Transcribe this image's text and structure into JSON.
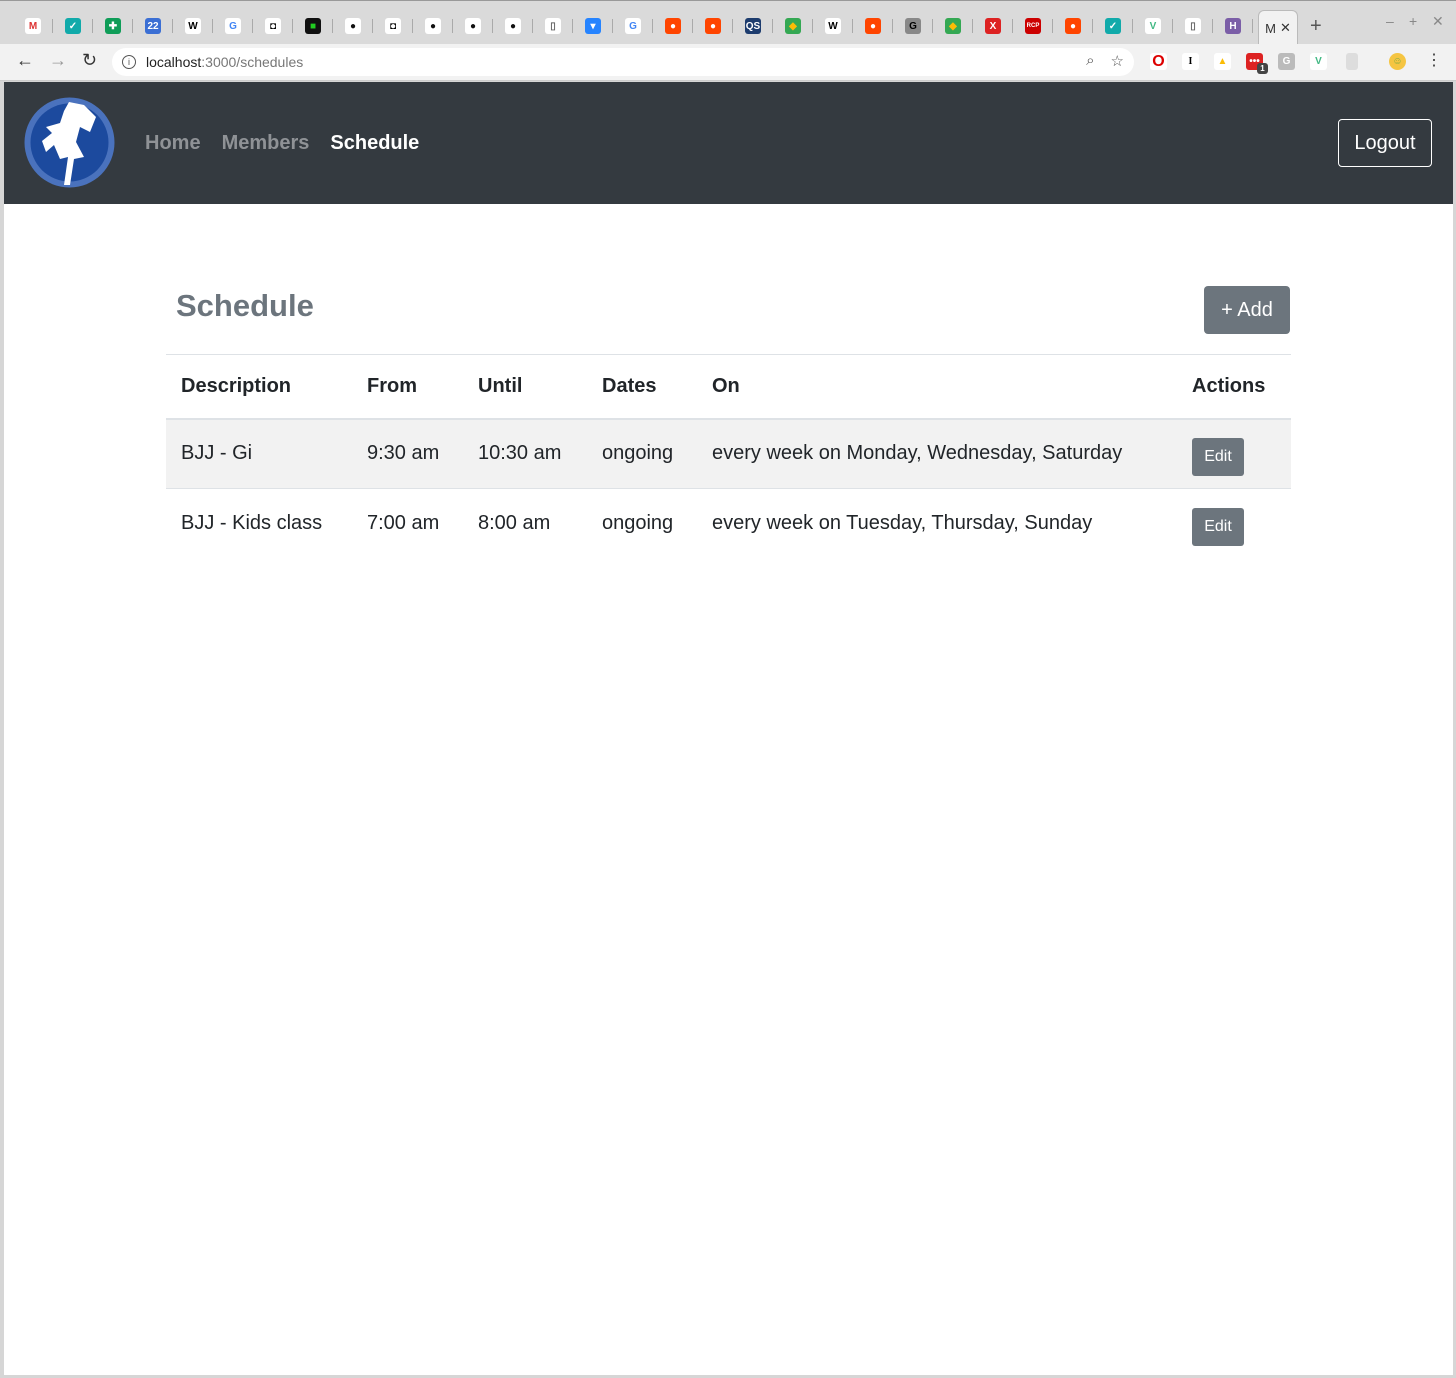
{
  "browser": {
    "tabs": [
      {
        "icon": "gmail-icon",
        "glyph": "M",
        "bg": "#fff",
        "fg": "#d33"
      },
      {
        "icon": "shield-icon",
        "glyph": "✓",
        "bg": "#1aa",
        "fg": "#fff"
      },
      {
        "icon": "sheets-icon",
        "glyph": "✚",
        "bg": "#0f9d58",
        "fg": "#fff"
      },
      {
        "icon": "calendar-icon",
        "glyph": "22",
        "bg": "#3b6fd4",
        "fg": "#fff"
      },
      {
        "icon": "wikipedia-icon",
        "glyph": "W",
        "bg": "#fff",
        "fg": "#000"
      },
      {
        "icon": "google-icon",
        "glyph": "G",
        "bg": "#fff",
        "fg": "#4285f4"
      },
      {
        "icon": "circle-icon",
        "glyph": "◘",
        "bg": "#fff",
        "fg": "#000"
      },
      {
        "icon": "app-icon",
        "glyph": "■",
        "bg": "#111",
        "fg": "#2c2"
      },
      {
        "icon": "github-icon",
        "glyph": "●",
        "bg": "#fff",
        "fg": "#111"
      },
      {
        "icon": "circle-icon",
        "glyph": "◘",
        "bg": "#fff",
        "fg": "#000"
      },
      {
        "icon": "github-icon",
        "glyph": "●",
        "bg": "#fff",
        "fg": "#111"
      },
      {
        "icon": "github-icon",
        "glyph": "●",
        "bg": "#fff",
        "fg": "#111"
      },
      {
        "icon": "github-icon",
        "glyph": "●",
        "bg": "#fff",
        "fg": "#111"
      },
      {
        "icon": "document-icon",
        "glyph": "▯",
        "bg": "#fff",
        "fg": "#666"
      },
      {
        "icon": "bitbucket-icon",
        "glyph": "▾",
        "bg": "#2684ff",
        "fg": "#fff"
      },
      {
        "icon": "google-icon",
        "glyph": "G",
        "bg": "#fff",
        "fg": "#4285f4"
      },
      {
        "icon": "reddit-icon",
        "glyph": "●",
        "bg": "#ff4500",
        "fg": "#fff"
      },
      {
        "icon": "reddit-icon",
        "glyph": "●",
        "bg": "#ff4500",
        "fg": "#fff"
      },
      {
        "icon": "qs-icon",
        "glyph": "QS",
        "bg": "#1d3c6e",
        "fg": "#fff"
      },
      {
        "icon": "maps-icon",
        "glyph": "◆",
        "bg": "#34a853",
        "fg": "#fbbc05"
      },
      {
        "icon": "wikipedia-icon",
        "glyph": "W",
        "bg": "#fff",
        "fg": "#000"
      },
      {
        "icon": "reddit-icon",
        "glyph": "●",
        "bg": "#ff4500",
        "fg": "#fff"
      },
      {
        "icon": "g-icon",
        "glyph": "G",
        "bg": "#888",
        "fg": "#000"
      },
      {
        "icon": "maps-icon",
        "glyph": "◆",
        "bg": "#34a853",
        "fg": "#fbbc05"
      },
      {
        "icon": "x-icon",
        "glyph": "X",
        "bg": "#d22",
        "fg": "#fff"
      },
      {
        "icon": "rcp-icon",
        "glyph": "RCP",
        "bg": "#c00",
        "fg": "#fff"
      },
      {
        "icon": "reddit-icon",
        "glyph": "●",
        "bg": "#ff4500",
        "fg": "#fff"
      },
      {
        "icon": "shield-icon",
        "glyph": "✓",
        "bg": "#1aa",
        "fg": "#fff"
      },
      {
        "icon": "vue-icon",
        "glyph": "V",
        "bg": "#fff",
        "fg": "#41b883"
      },
      {
        "icon": "document-icon",
        "glyph": "▯",
        "bg": "#fff",
        "fg": "#666"
      },
      {
        "icon": "heroku-icon",
        "glyph": "H",
        "bg": "#7b5ea7",
        "fg": "#fff"
      }
    ],
    "active_tab_label": "M",
    "url_host": "localhost",
    "url_path": ":3000/schedules",
    "extension_badge": "1"
  },
  "nav": {
    "home": "Home",
    "members": "Members",
    "schedule": "Schedule",
    "logout": "Logout"
  },
  "page": {
    "title": "Schedule",
    "add_label": "+ Add"
  },
  "table": {
    "headers": [
      "Description",
      "From",
      "Until",
      "Dates",
      "On",
      "Actions"
    ],
    "rows": [
      {
        "description": "BJJ - Gi",
        "from": "9:30 am",
        "until": "10:30 am",
        "dates": "ongoing",
        "on": "every week on Monday, Wednesday, Saturday",
        "action": "Edit"
      },
      {
        "description": "BJJ - Kids class",
        "from": "7:00 am",
        "until": "8:00 am",
        "dates": "ongoing",
        "on": "every week on Tuesday, Thursday, Sunday",
        "action": "Edit"
      }
    ]
  }
}
